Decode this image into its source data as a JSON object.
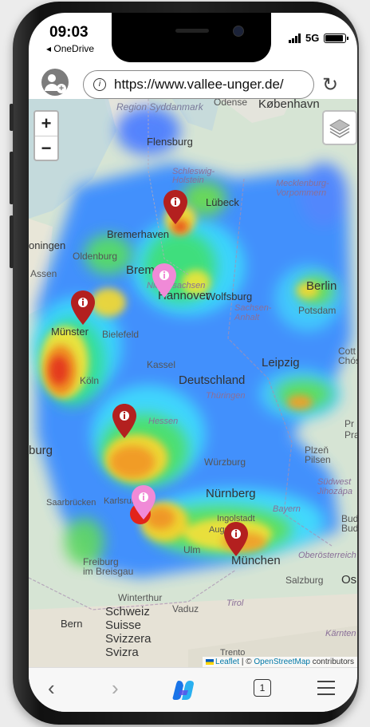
{
  "status": {
    "time": "09:03",
    "back_app": "◂ OneDrive",
    "network": "5G"
  },
  "browser": {
    "url": "https://www.vallee-unger.de/",
    "tab_count": "1"
  },
  "map": {
    "zoom_in": "+",
    "zoom_out": "−",
    "attribution": {
      "leaflet": "Leaflet",
      "separator": " | © ",
      "osm": "OpenStreetMap",
      "contributors": " contributors"
    },
    "places": {
      "region_syddanmark": "Region Syddanmark",
      "odense": "Odense",
      "kobenhavn": "København",
      "flensburg": "Flensburg",
      "schleswig_holstein": "Schleswig-\nHolstein",
      "lubeck": "Lübeck",
      "mecklenburg": "Mecklenburg-\nVorpommern",
      "bremerhaven": "Bremerhaven",
      "groningen": "oningen",
      "oldenburg": "Oldenburg",
      "assen": "Assen",
      "bremen": "Bremen",
      "niedersachsen": "Niedersachsen",
      "hannover": "Hannover",
      "wolfsburg": "Wolfsburg",
      "berlin": "Berlin",
      "potsdam": "Potsdam",
      "sachsen_anhalt": "Sachsen-\nAnhalt",
      "munster": "Münster",
      "bielefeld": "Bielefeld",
      "kassel": "Kassel",
      "leipzig": "Leipzig",
      "cottbus": "Cott\nChós",
      "deutschland": "Deutschland",
      "thuringen": "Thüringen",
      "koln": "Köln",
      "hessen": "Hessen",
      "burg": "burg",
      "wurzburg": "Würzburg",
      "plzen": "Plzeň\nPilsen",
      "pra": "Pr\nPra",
      "nurnberg": "Nürnberg",
      "saarbrucken": "Saarbrücken",
      "karlsruhe": "Karlsruhe",
      "jihozapad": "Südwest\nJihozápa",
      "ingolstadt": "Ingolstadt",
      "bayern": "Bayern",
      "bude": "Bude\nBud",
      "ulm": "Ulm",
      "augsburg": "Augsburg",
      "munchen": "München",
      "oberosterreich": "Oberösterreich",
      "freiburg": "Freiburg\nim Breisgau",
      "salzburg": "Salzburg",
      "os": "Os",
      "winterthur": "Winterthur",
      "tirol": "Tirol",
      "bern": "Bern",
      "schweiz": "Schweiz\nSuisse\nSvizzera\nSvizra",
      "vaduz": "Vaduz",
      "karnten": "Kärnten",
      "trento": "Trento"
    }
  },
  "colors": {
    "pin_dark": "#b3201f",
    "pin_light": "#f08ad7",
    "heat_hot": "#e2241a"
  },
  "icons": [
    "profile-icon",
    "info-icon",
    "reload-icon",
    "layers-icon",
    "back-icon",
    "forward-icon",
    "copilot-icon",
    "tabs-icon",
    "menu-icon",
    "map-marker-icon"
  ]
}
